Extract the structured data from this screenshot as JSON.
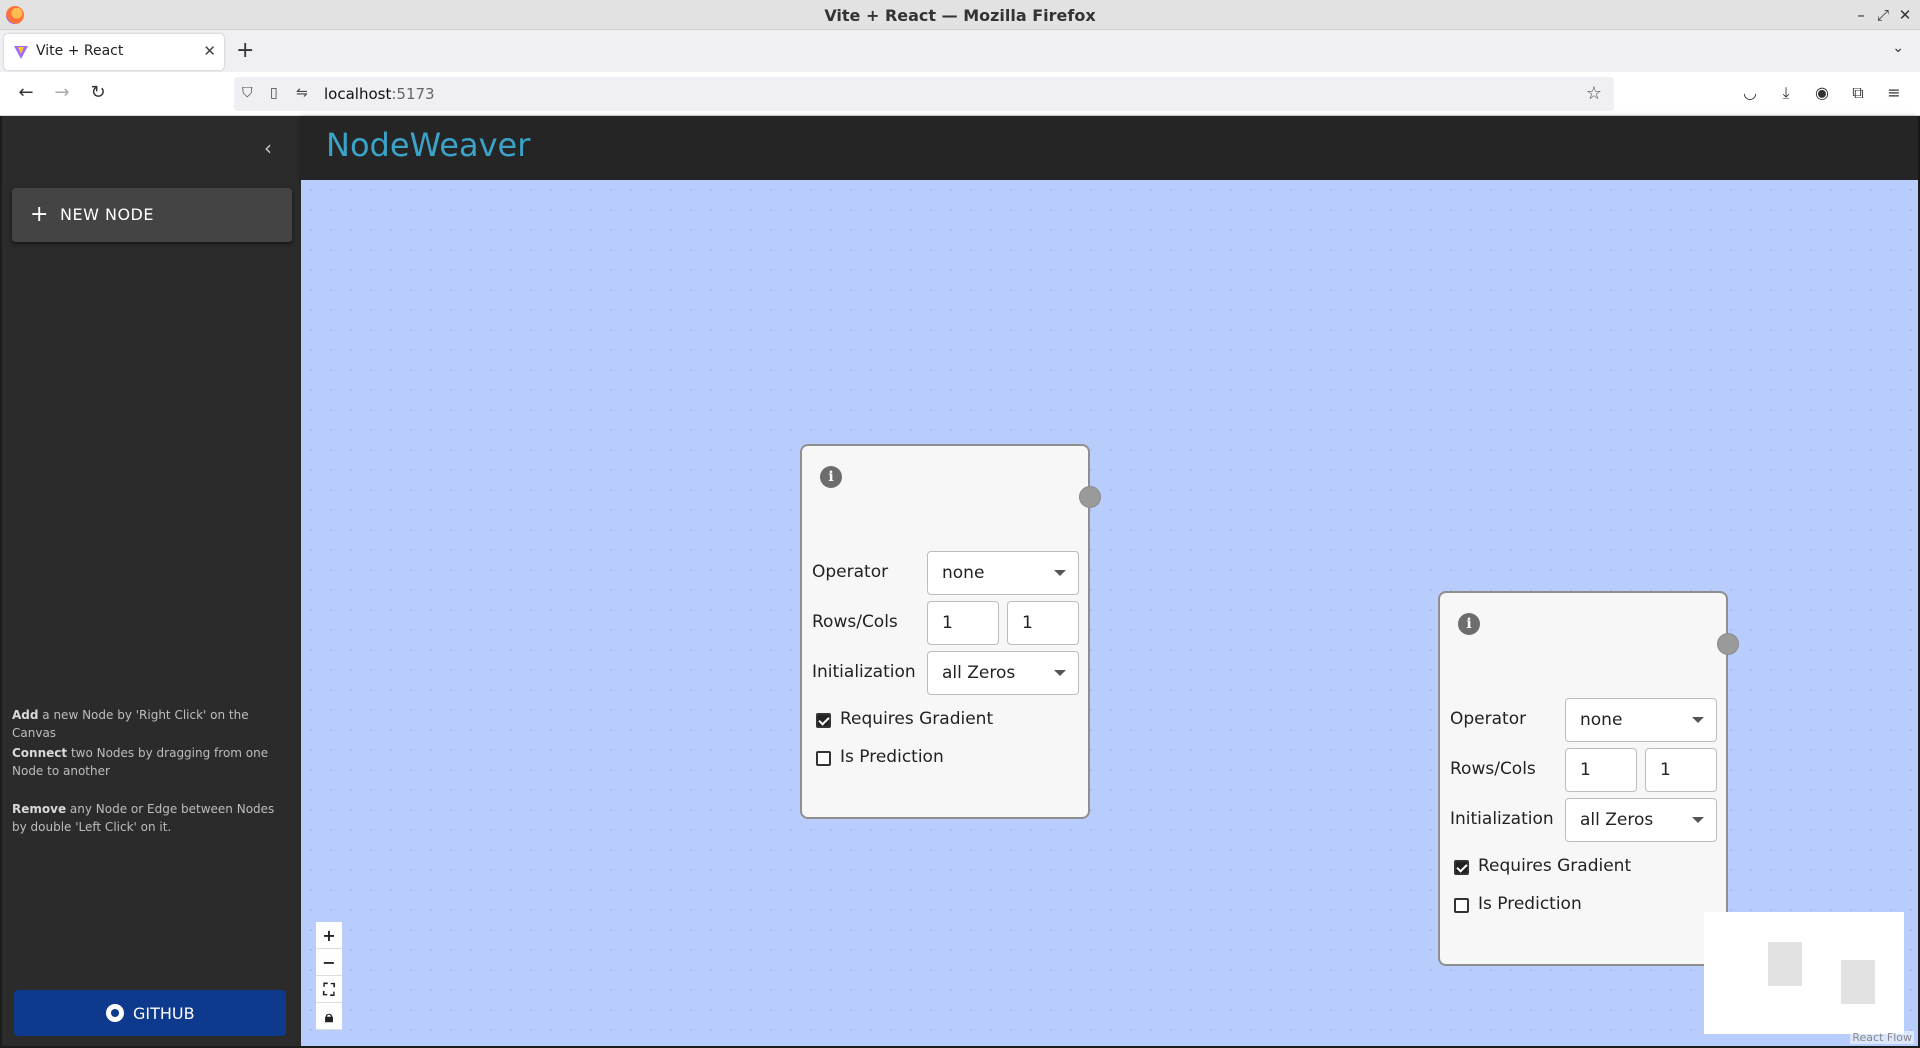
{
  "window": {
    "title": "Vite + React — Mozilla Firefox"
  },
  "browser": {
    "tab": {
      "label": "Vite + React"
    },
    "url_host": "localhost",
    "url_port": ":5173"
  },
  "sidebar": {
    "new_node_label": "NEW NODE",
    "help": [
      {
        "bold": "Add",
        "text": " a new Node by 'Right Click' on the Canvas"
      },
      {
        "bold": "Connect",
        "text": " two Nodes by dragging from one Node to another"
      },
      {
        "bold": "Remove",
        "text": " any Node or Edge between Nodes by double 'Left Click' on it."
      }
    ],
    "github_label": "GITHUB"
  },
  "header": {
    "brand": "NodeWeaver",
    "brand_color": "#3ba3c7"
  },
  "nodes": [
    {
      "operator_label": "Operator",
      "operator_value": "none",
      "rowscols_label": "Rows/Cols",
      "rows": "1",
      "cols": "1",
      "init_label": "Initialization",
      "init_value": "all Zeros",
      "requires_gradient_label": "Requires Gradient",
      "requires_gradient": true,
      "is_prediction_label": "Is Prediction",
      "is_prediction": false
    },
    {
      "operator_label": "Operator",
      "operator_value": "none",
      "rowscols_label": "Rows/Cols",
      "rows": "1",
      "cols": "1",
      "init_label": "Initialization",
      "init_value": "all Zeros",
      "requires_gradient_label": "Requires Gradient",
      "requires_gradient": true,
      "is_prediction_label": "Is Prediction",
      "is_prediction": false
    }
  ],
  "canvas": {
    "background": "#b9cdfc",
    "attribution": "React Flow"
  }
}
